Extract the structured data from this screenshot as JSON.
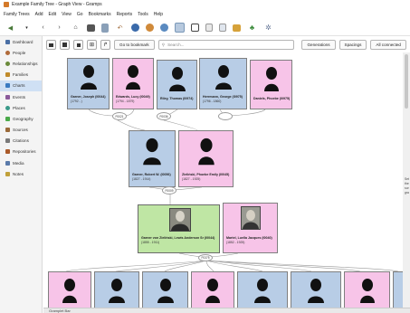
{
  "window": {
    "title": "Example Family Tree - Graph View - Gramps"
  },
  "menu": [
    "Family Trees",
    "Add",
    "Edit",
    "View",
    "Go",
    "Bookmarks",
    "Reports",
    "Tools",
    "Help"
  ],
  "sidebar": {
    "items": [
      {
        "label": "Dashboard",
        "icon": "dashboard-icon",
        "color": "#4a6fa5"
      },
      {
        "label": "People",
        "icon": "people-icon",
        "color": "#b06a3a"
      },
      {
        "label": "Relationships",
        "icon": "relationships-icon",
        "color": "#6a8a3a"
      },
      {
        "label": "Families",
        "icon": "families-icon",
        "color": "#c08a2a"
      },
      {
        "label": "Charts",
        "icon": "charts-icon",
        "color": "#3a7ac0"
      },
      {
        "label": "Events",
        "icon": "events-icon",
        "color": "#8a5a9a"
      },
      {
        "label": "Places",
        "icon": "places-icon",
        "color": "#3a9a8a"
      },
      {
        "label": "Geography",
        "icon": "geography-icon",
        "color": "#4aaa4a"
      },
      {
        "label": "Sources",
        "icon": "sources-icon",
        "color": "#9a6a3a"
      },
      {
        "label": "Citations",
        "icon": "citations-icon",
        "color": "#7a7a7a"
      },
      {
        "label": "Repositories",
        "icon": "repositories-icon",
        "color": "#aa5a2a"
      },
      {
        "label": "Media",
        "icon": "media-icon",
        "color": "#5a7aaa"
      },
      {
        "label": "Notes",
        "icon": "notes-icon",
        "color": "#c0a03a"
      }
    ],
    "active": "Charts"
  },
  "navbar": {
    "bookmark_label": "Go to bookmark",
    "search_placeholder": "Search...",
    "generations_label": "Generations",
    "spacings_label": "Spacings",
    "all_connected_label": "All connected"
  },
  "graph": {
    "people": [
      {
        "id": "p1",
        "name": "Garner, Joseph (I0044)",
        "dates": "(1792 - )",
        "gender": "male"
      },
      {
        "id": "p2",
        "name": "Edwards, Lucy (I0049)",
        "dates": "(1794 - 1879)",
        "gender": "female"
      },
      {
        "id": "p3",
        "name": "Riley, Thomas (I0974)",
        "dates": "",
        "gender": "male"
      },
      {
        "id": "p4",
        "name": "Herrmann, George (I0975)",
        "dates": "(1796 - 1860)",
        "gender": "male"
      },
      {
        "id": "p5",
        "name": "Daniels, Phoebe (I0975)",
        "dates": "",
        "gender": "female"
      },
      {
        "id": "p6",
        "name": "Garner, Robert W. (I0056)",
        "dates": "(1827 - 1914)",
        "gender": "male"
      },
      {
        "id": "p7",
        "name": "Zieliński, Phoebe Emily (I0045)",
        "dates": "(1827 - 1925)",
        "gender": "female"
      },
      {
        "id": "p8",
        "name": "Garner von Zieliński, Lewis Anderson Sr (I0044)",
        "dates": "(1855 - 1911)",
        "gender": "selected"
      },
      {
        "id": "p9",
        "name": "Martel, Luella Jacques (I0040)",
        "dates": "(1852 - 1925)",
        "gender": "female"
      }
    ],
    "families": [
      {
        "id": "f1",
        "label": "F0021"
      },
      {
        "id": "f2",
        "label": "F0036"
      },
      {
        "id": "f3",
        "label": ""
      },
      {
        "id": "f4",
        "label": "F0009"
      },
      {
        "id": "f5",
        "label": "F0375"
      }
    ]
  },
  "bottombar": {
    "label": "Gramplet Bar"
  },
  "right_partial": [
    "Set",
    "the",
    "sor",
    "gra"
  ]
}
